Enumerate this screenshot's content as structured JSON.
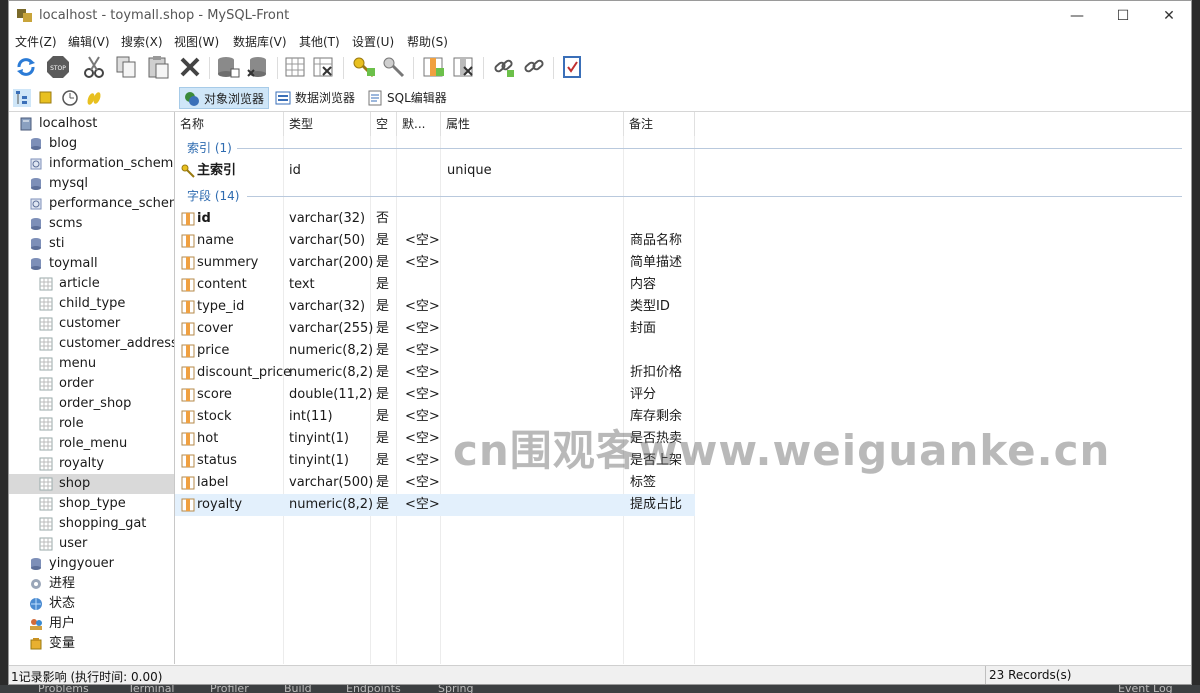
{
  "window": {
    "title": "localhost - toymall.shop - MySQL-Front",
    "controls": {
      "minimize": "—",
      "maximize": "☐",
      "close": "✕"
    }
  },
  "menu": [
    "文件(Z)",
    "编辑(V)",
    "搜索(X)",
    "视图(W)",
    "数据库(V)",
    "其他(T)",
    "设置(U)",
    "帮助(S)"
  ],
  "toolbar": {
    "buttons": [
      "refresh-icon",
      "stop-icon",
      "cut-icon",
      "copy-icon",
      "paste-icon",
      "delete-icon",
      "database-add-icon",
      "database-delete-icon",
      "table-add-icon",
      "table-delete-icon",
      "key-add-icon",
      "key-delete-icon",
      "field-add-icon",
      "field-delete-icon",
      "link-add-icon",
      "link-delete-icon",
      "properties-icon"
    ],
    "stop_label": "STOP"
  },
  "subbar": {
    "side_icons": [
      "tree-view-icon",
      "bookmark-icon",
      "history-icon",
      "sql-snippet-icon"
    ],
    "tabs": [
      {
        "label": "对象浏览器",
        "active": true,
        "icon": "object-browser-icon"
      },
      {
        "label": "数据浏览器",
        "active": false,
        "icon": "data-browser-icon"
      },
      {
        "label": "SQL编辑器",
        "active": false,
        "icon": "sql-editor-icon"
      }
    ]
  },
  "tree": {
    "root": "localhost",
    "databases_before": [
      "blog",
      "information_schema",
      "mysql",
      "performance_schema",
      "scms",
      "sti",
      "toymall"
    ],
    "tables": [
      "article",
      "child_type",
      "customer",
      "customer_address",
      "menu",
      "order",
      "order_shop",
      "role",
      "role_menu",
      "royalty",
      "shop",
      "shop_type",
      "shopping_gat",
      "user"
    ],
    "selected_table": "shop",
    "databases_after": [
      "yingyouer"
    ],
    "system_nodes": [
      "进程",
      "状态",
      "用户",
      "变量"
    ]
  },
  "grid": {
    "columns": [
      "名称",
      "类型",
      "空",
      "默...",
      "属性",
      "备注"
    ],
    "groups": {
      "index": "索引 (1)",
      "fields": "字段 (14)"
    },
    "index_rows": [
      {
        "name": "主索引",
        "type": "id",
        "null": "",
        "default": "",
        "attr": "unique",
        "comment": ""
      }
    ],
    "field_rows": [
      {
        "name": "id",
        "type": "varchar(32)",
        "null": "否",
        "default": "",
        "comment": "",
        "primary": true
      },
      {
        "name": "name",
        "type": "varchar(50)",
        "null": "是",
        "default": "<空>",
        "comment": "商品名称"
      },
      {
        "name": "summery",
        "type": "varchar(200)",
        "null": "是",
        "default": "<空>",
        "comment": "简单描述"
      },
      {
        "name": "content",
        "type": "text",
        "null": "是",
        "default": "",
        "comment": "内容"
      },
      {
        "name": "type_id",
        "type": "varchar(32)",
        "null": "是",
        "default": "<空>",
        "comment": "类型ID"
      },
      {
        "name": "cover",
        "type": "varchar(255)",
        "null": "是",
        "default": "<空>",
        "comment": "封面"
      },
      {
        "name": "price",
        "type": "numeric(8,2)",
        "null": "是",
        "default": "<空>",
        "comment": ""
      },
      {
        "name": "discount_price",
        "type": "numeric(8,2)",
        "null": "是",
        "default": "<空>",
        "comment": "折扣价格"
      },
      {
        "name": "score",
        "type": "double(11,2)",
        "null": "是",
        "default": "<空>",
        "comment": "评分"
      },
      {
        "name": "stock",
        "type": "int(11)",
        "null": "是",
        "default": "<空>",
        "comment": "库存剩余"
      },
      {
        "name": "hot",
        "type": "tinyint(1)",
        "null": "是",
        "default": "<空>",
        "comment": " 是否热卖"
      },
      {
        "name": "status",
        "type": "tinyint(1)",
        "null": "是",
        "default": "<空>",
        "comment": "是否上架"
      },
      {
        "name": "label",
        "type": "varchar(500)",
        "null": "是",
        "default": "<空>",
        "comment": "标签"
      },
      {
        "name": "royalty",
        "type": "numeric(8,2)",
        "null": "是",
        "default": "<空>",
        "comment": "提成占比",
        "selected": true
      }
    ]
  },
  "status": {
    "left": "1记录影响  (执行时间: 0.00)",
    "right": "23 Records(s)"
  },
  "watermark": "cn围观客www.weiguanke.cn",
  "ide_tabs": [
    "Problems",
    "Terminal",
    "Profiler",
    "Build",
    "Endpoints",
    "Spring",
    "Event Log"
  ],
  "colors": {
    "accent": "#2e6bb0",
    "tab_active_bg": "#cfe6f8",
    "row_selected_bg": "#e3f0fc",
    "tree_selected_bg": "#d9d9d9"
  }
}
